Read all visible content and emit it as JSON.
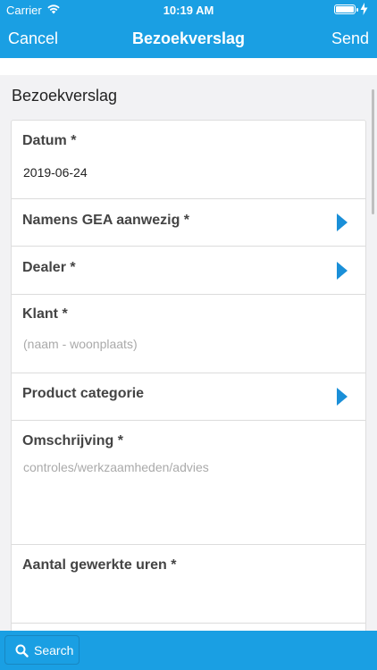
{
  "status_bar": {
    "carrier": "Carrier",
    "time": "10:19 AM"
  },
  "nav": {
    "cancel_label": "Cancel",
    "title": "Bezoekverslag",
    "send_label": "Send"
  },
  "section": {
    "title": "Bezoekverslag"
  },
  "form": {
    "datum": {
      "label": "Datum *",
      "value": "2019-06-24"
    },
    "namens": {
      "label": "Namens GEA aanwezig *"
    },
    "dealer": {
      "label": "Dealer *"
    },
    "klant": {
      "label": "Klant *",
      "placeholder": "(naam - woonplaats)"
    },
    "product": {
      "label": "Product categorie"
    },
    "omschrijving": {
      "label": "Omschrijving *",
      "placeholder": "controles/werkzaamheden/advies"
    },
    "uren": {
      "label": "Aantal gewerkte uren *"
    }
  },
  "bottom": {
    "search_label": "Search"
  },
  "colors": {
    "accent": "#1a9fe3",
    "chevron": "#1a8fd8"
  }
}
